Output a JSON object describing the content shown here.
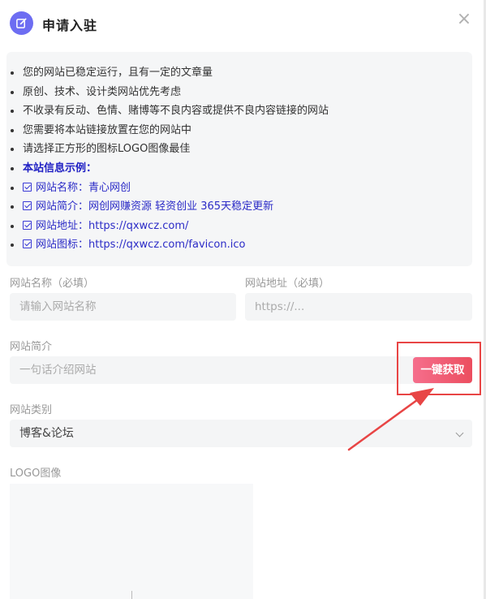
{
  "dialog": {
    "title": "申请入驻",
    "close_symbol": "×"
  },
  "notice": {
    "items": [
      "您的网站已稳定运行，且有一定的文章量",
      "原创、技术、设计类网站优先考虑",
      "不收录有反动、色情、赌博等不良内容或提供不良内容链接的网站",
      "您需要将本站链接放置在您的网站中",
      "请选择正方形的图标LOGO图像最佳"
    ],
    "example_heading": "本站信息示例：",
    "examples": [
      "网站名称：青心网创",
      "网站简介：网创网赚资源 轻资创业 365天稳定更新",
      "网站地址：https://qxwcz.com/",
      "网站图标：https://qxwcz.com/favicon.ico"
    ]
  },
  "form": {
    "site_name_label": "网站名称（必填）",
    "site_name_placeholder": "请输入网站名称",
    "site_url_label": "网站地址（必填）",
    "site_url_placeholder": "https://...",
    "site_desc_label": "网站简介",
    "site_desc_placeholder": "一句话介绍网站",
    "fetch_button": "一键获取",
    "category_label": "网站类别",
    "category_value": "博客&论坛",
    "logo_label": "LOGO图像"
  },
  "colors": {
    "accent": "#6d6df2",
    "button_gradient_start": "#f56e8c",
    "button_gradient_end": "#ec4e5f",
    "annotation_red": "#e84545",
    "example_blue": "#2b2bc7"
  }
}
